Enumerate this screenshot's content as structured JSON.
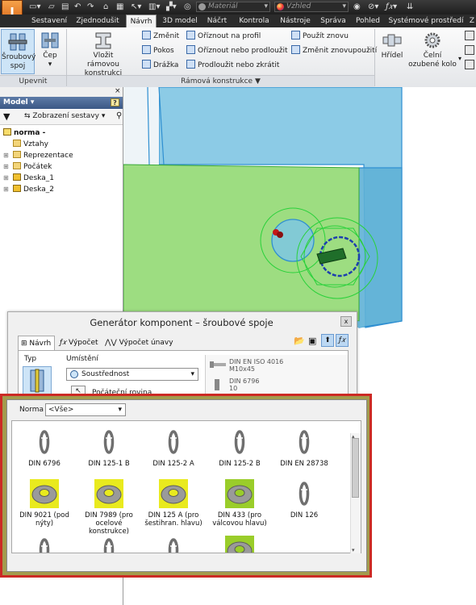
{
  "titlebar": {
    "material_placeholder": "Materiál",
    "appearance_placeholder": "Vzhled"
  },
  "tabs": [
    "Sestavení",
    "Zjednodušit",
    "Návrh",
    "3D model",
    "Náčrt",
    "Kontrola",
    "Nástroje",
    "Správa",
    "Pohled",
    "Systémové prostředí",
    "Z"
  ],
  "active_tab": "Návrh",
  "ribbon": {
    "upevnit": {
      "panel_label": "Upevnit",
      "bolt_label": [
        "Šroubový",
        "spoj"
      ],
      "pin_label": [
        "Čep"
      ]
    },
    "frame": {
      "insert_label": [
        "Vložit",
        "rámovou konstrukci"
      ],
      "col1": [
        "Změnit",
        "Pokos",
        "Drážka"
      ],
      "col2": [
        "Oříznout na profil",
        "Oříznout nebo prodloužit",
        "Prodloužit nebo zkrátit"
      ],
      "col3": [
        "Použít znovu",
        "Změnit znovupoužití"
      ],
      "panel_label": "Rámová konstrukce ▼"
    },
    "power": {
      "shaft_label": "Hřídel",
      "gear_label": [
        "Čelní",
        "ozubené kolo"
      ]
    }
  },
  "browser": {
    "header": "Model ▾",
    "help": "?",
    "filter_label": "Zobrazení sestavy",
    "tree": [
      {
        "label": "norma -",
        "level": 0,
        "icon": "assembly-icon",
        "bold": true
      },
      {
        "label": "Vztahy",
        "level": 1,
        "icon": "folder-icon"
      },
      {
        "label": "Reprezentace",
        "level": 1,
        "icon": "folder-icon",
        "expand": true
      },
      {
        "label": "Počátek",
        "level": 1,
        "icon": "folder-icon",
        "expand": true
      },
      {
        "label": "Deska_1",
        "level": 1,
        "icon": "part-icon",
        "expand": true
      },
      {
        "label": "Deska_2",
        "level": 1,
        "icon": "part-icon",
        "expand": true
      }
    ]
  },
  "dialog": {
    "title": "Generátor komponent – šroubové spoje",
    "close": "x",
    "tabs": [
      "Návrh",
      "Výpočet",
      "Výpočet únavy materiálu"
    ],
    "type_label": "Typ",
    "placement_label": "Umístění",
    "placement_value": "Soustřednost",
    "start_plane": "Počáteční rovina",
    "components": [
      {
        "line1": "DIN EN ISO  4016",
        "line2": "M10x45"
      },
      {
        "line1": "DIN  6796",
        "line2": "10"
      }
    ]
  },
  "popup": {
    "norm_label": "Norma",
    "norm_value": "<Vše>",
    "rows": [
      [
        {
          "label": [
            "DIN  6796"
          ],
          "style": "lock",
          "highlight": false
        },
        {
          "label": [
            "DIN  125-1 B"
          ],
          "style": "lock",
          "highlight": false
        },
        {
          "label": [
            "DIN  125-2 A"
          ],
          "style": "lock",
          "highlight": false
        },
        {
          "label": [
            "DIN  125-2 B"
          ],
          "style": "lock",
          "highlight": false
        },
        {
          "label": [
            "DIN EN  28738"
          ],
          "style": "lock",
          "highlight": false
        }
      ],
      [
        {
          "label": [
            "DIN  9021 (pod",
            "nýty)"
          ],
          "style": "flat",
          "highlight": true
        },
        {
          "label": [
            "DIN  7989 (pro",
            "ocelové konstrukce)"
          ],
          "style": "flat",
          "highlight": true
        },
        {
          "label": [
            "DIN  125 A (pro",
            "šestihran. hlavu)"
          ],
          "style": "flat",
          "highlight": true
        },
        {
          "label": [
            "DIN  433 (pro",
            "válcovou hlavu)"
          ],
          "style": "flat",
          "highlight": true,
          "green": true
        },
        {
          "label": [
            "DIN  126"
          ],
          "style": "lock",
          "highlight": false
        }
      ],
      [
        {
          "label": [
            ""
          ],
          "style": "lock",
          "highlight": false
        },
        {
          "label": [
            ""
          ],
          "style": "lock",
          "highlight": false
        },
        {
          "label": [
            ""
          ],
          "style": "lock",
          "highlight": false
        },
        {
          "label": [
            ""
          ],
          "style": "flat",
          "highlight": true,
          "green": true
        }
      ]
    ]
  },
  "colors": {
    "accent_frame": "#cc2a24",
    "highlight_yellow": "#e9ea1e",
    "highlight_green": "#9acd2a",
    "plate_blue": "#6cb9da",
    "plate_green": "#8fd870"
  }
}
